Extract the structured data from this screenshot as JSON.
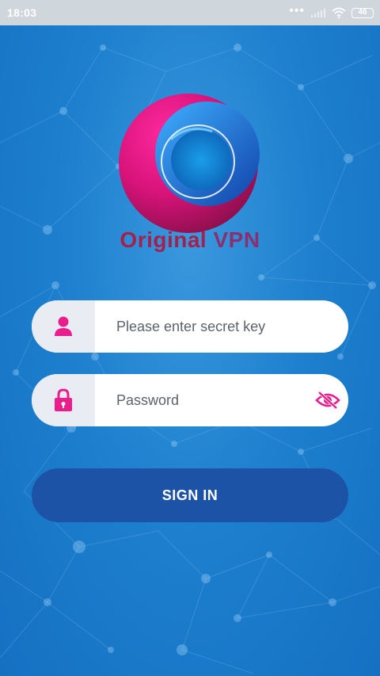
{
  "status_bar": {
    "time": "18:03",
    "battery": "46",
    "signal_dots": "•••"
  },
  "brand": {
    "word1": "Original",
    "word2": "VPN"
  },
  "login": {
    "secret_key_placeholder": "Please enter secret key",
    "password_placeholder": "Password",
    "sign_in_label": "SIGN IN"
  },
  "colors": {
    "accent_pink": "#e91e8c",
    "button_blue": "#1d53a6",
    "background_blue": "#1877c9"
  },
  "icons": {
    "key_field": "person-icon",
    "password_field": "lock-icon",
    "password_toggle": "eye-off-icon",
    "status": [
      "wifi-icon",
      "signal-icon",
      "battery-icon"
    ]
  }
}
